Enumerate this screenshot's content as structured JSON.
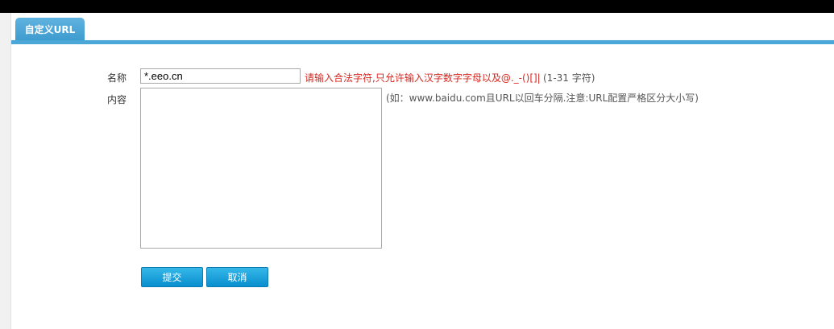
{
  "tab": {
    "label": "自定义URL"
  },
  "form": {
    "name_label": "名称",
    "name_value": "*.eeo.cn",
    "name_error_hint": "请输入合法字符,只允许输入汉字数字字母以及@._-()[]|",
    "name_range_hint": "(1-31 字符)",
    "content_label": "内容",
    "content_value": "",
    "content_hint": "(如：www.baidu.com且URL以回车分隔.注意:URL配置严格区分大小写)"
  },
  "buttons": {
    "submit": "提交",
    "cancel": "取消"
  },
  "colors": {
    "accent": "#4aa7d8",
    "error": "#d9251d",
    "button": "#0a8fcf"
  }
}
